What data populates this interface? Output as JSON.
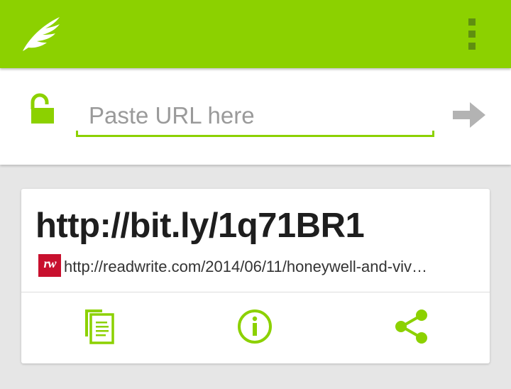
{
  "colors": {
    "accent": "#8cd100",
    "accent_dark": "#5f8f10",
    "favicon_red": "#c8102e",
    "arrow_gray": "#b3b3b3",
    "background": "#e6e6e6"
  },
  "action_bar": {
    "logo_icon": "wing-logo-icon",
    "menu_icon": "overflow-menu-icon"
  },
  "url_input": {
    "value": "",
    "placeholder": "Paste URL here",
    "lock_icon": "unlocked-padlock-icon",
    "submit_icon": "arrow-right-icon"
  },
  "card": {
    "short_url": "http://bit.ly/1q71BR1",
    "favicon_text": "rw",
    "long_url": "http://readwrite.com/2014/06/11/honeywell-and-viv…",
    "actions": [
      {
        "name": "copy",
        "icon": "copy-icon"
      },
      {
        "name": "info",
        "icon": "info-icon"
      },
      {
        "name": "share",
        "icon": "share-icon"
      }
    ]
  }
}
